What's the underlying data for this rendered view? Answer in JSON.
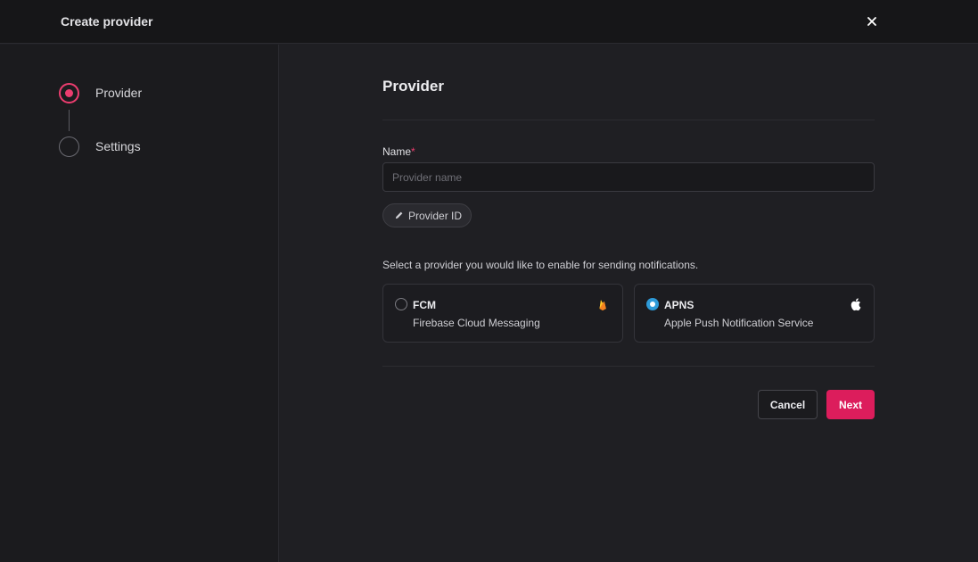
{
  "header": {
    "title": "Create provider",
    "close_icon": "close-icon"
  },
  "steps": [
    {
      "label": "Provider",
      "state": "active"
    },
    {
      "label": "Settings",
      "state": "pending"
    }
  ],
  "form": {
    "section_title": "Provider",
    "name_label": "Name",
    "required_marker": "*",
    "name_placeholder": "Provider name",
    "name_value": "",
    "provider_id_label": "Provider ID",
    "hint": "Select a provider you would like to enable for sending notifications."
  },
  "providers": [
    {
      "title": "FCM",
      "subtitle": "Firebase Cloud Messaging",
      "icon": "firebase-icon",
      "selected": false
    },
    {
      "title": "APNS",
      "subtitle": "Apple Push Notification Service",
      "icon": "apple-icon",
      "selected": true
    }
  ],
  "actions": {
    "cancel_label": "Cancel",
    "next_label": "Next"
  },
  "colors": {
    "accent": "#dc1d5c",
    "step_active": "#ec3d6f",
    "radio_selected": "#2e9ad8"
  }
}
